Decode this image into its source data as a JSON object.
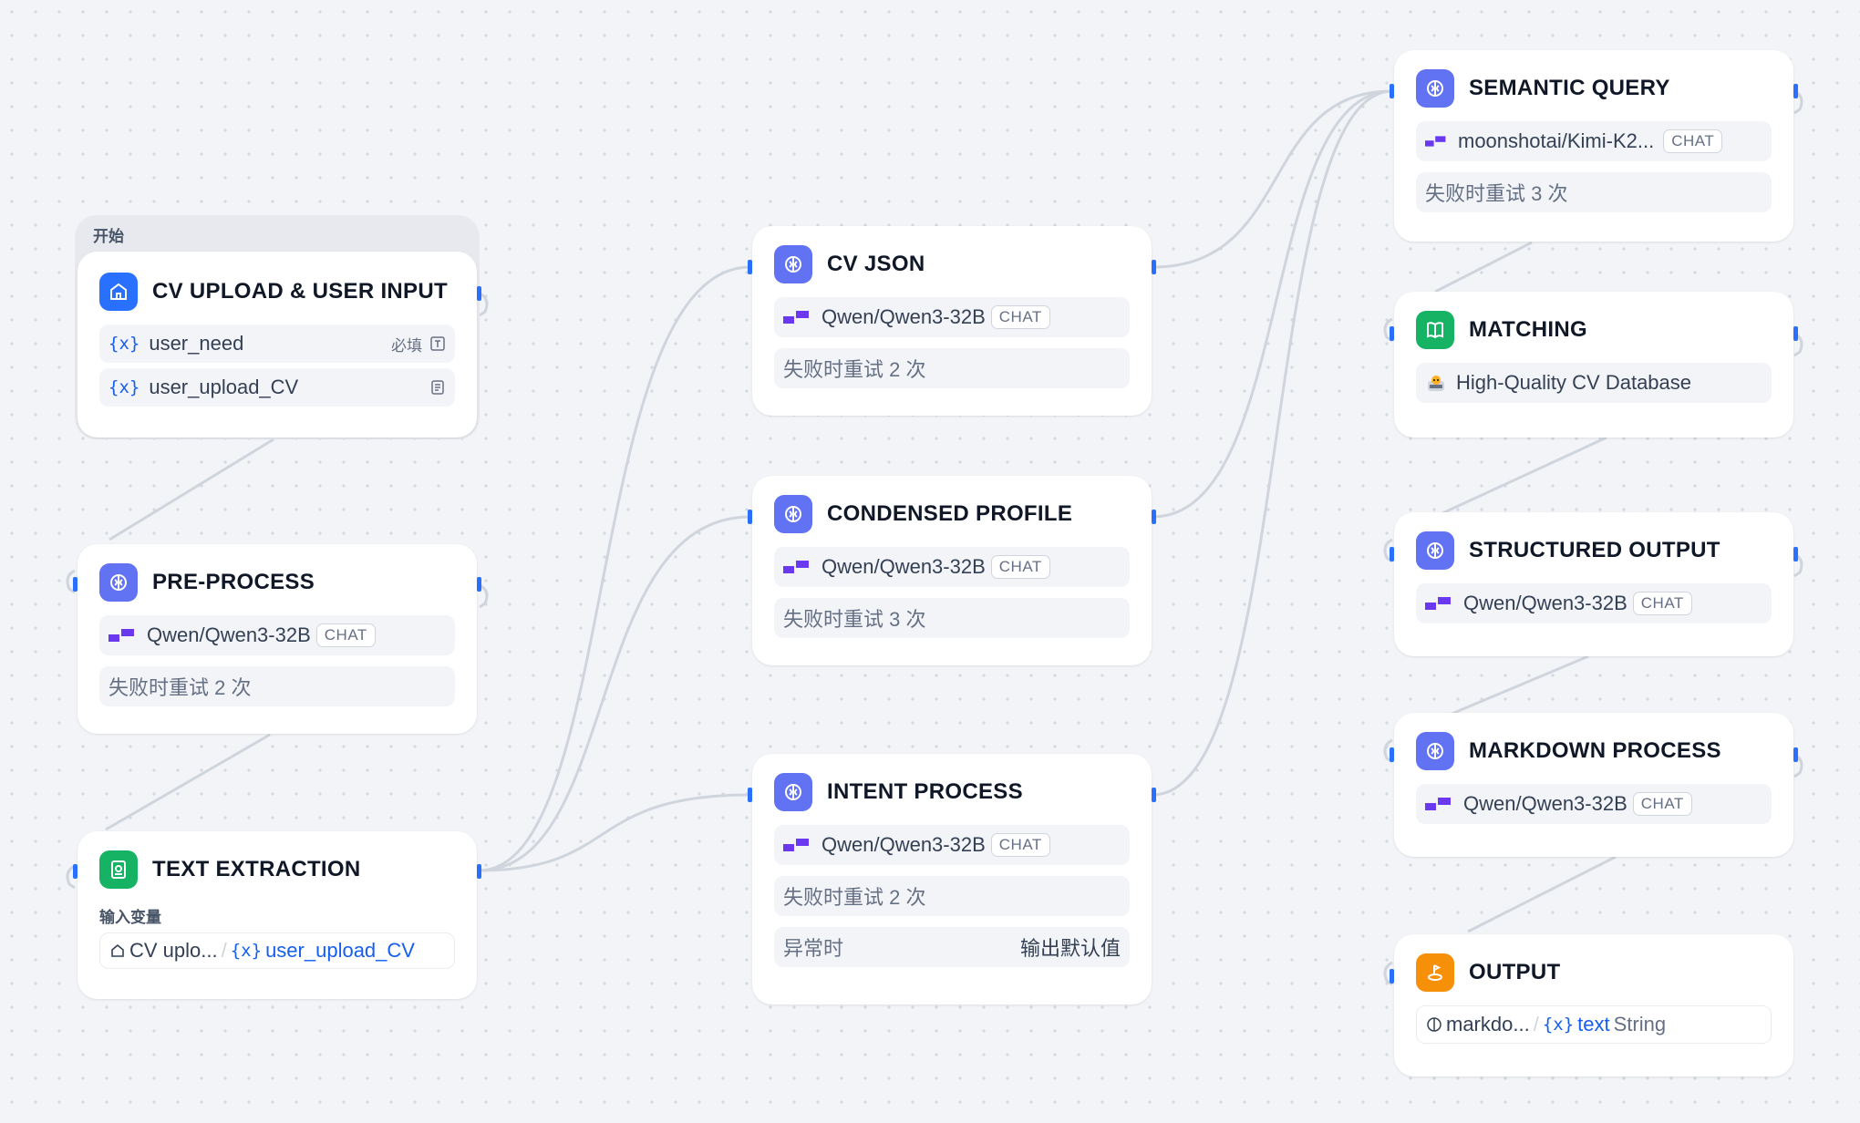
{
  "start_group_label": "开始",
  "nodes": {
    "cv_upload": {
      "title": "CV UPLOAD & USER INPUT",
      "vars": [
        {
          "name": "user_need",
          "badge": "必填"
        },
        {
          "name": "user_upload_CV",
          "badge": ""
        }
      ]
    },
    "pre_process": {
      "title": "PRE-PROCESS",
      "model": "Qwen/Qwen3-32B",
      "tag": "CHAT",
      "retry": "失败时重试 2 次"
    },
    "text_extraction": {
      "title": "TEXT EXTRACTION",
      "input_label": "输入变量",
      "source": "CV uplo...",
      "separator": "/",
      "var": "user_upload_CV"
    },
    "cv_json": {
      "title": "CV JSON",
      "model": "Qwen/Qwen3-32B",
      "tag": "CHAT",
      "retry": "失败时重试 2 次"
    },
    "condensed_profile": {
      "title": "CONDENSED PROFILE",
      "model": "Qwen/Qwen3-32B",
      "tag": "CHAT",
      "retry": "失败时重试 3 次"
    },
    "intent_process": {
      "title": "INTENT PROCESS",
      "model": "Qwen/Qwen3-32B",
      "tag": "CHAT",
      "retry": "失败时重试 2 次",
      "error_label": "异常时",
      "error_value": "输出默认值"
    },
    "semantic_query": {
      "title": "SEMANTIC QUERY",
      "model": "moonshotai/Kimi-K2...",
      "tag": "CHAT",
      "retry": "失败时重试 3 次"
    },
    "matching": {
      "title": "MATCHING",
      "dataset": "High-Quality CV Database"
    },
    "structured_output": {
      "title": "STRUCTURED OUTPUT",
      "model": "Qwen/Qwen3-32B",
      "tag": "CHAT"
    },
    "markdown_process": {
      "title": "MARKDOWN PROCESS",
      "model": "Qwen/Qwen3-32B",
      "tag": "CHAT"
    },
    "output": {
      "title": "OUTPUT",
      "source": "markdo...",
      "separator": "/",
      "var": "text",
      "type": "String"
    }
  },
  "colors": {
    "llm_icon": "#6172f3",
    "start_icon": "#2970ff",
    "extract_icon": "#16b364",
    "knowledge_icon": "#16b364",
    "output_icon": "#f79009",
    "edge": "#d0d5dd",
    "var_blue": "#155eef"
  }
}
